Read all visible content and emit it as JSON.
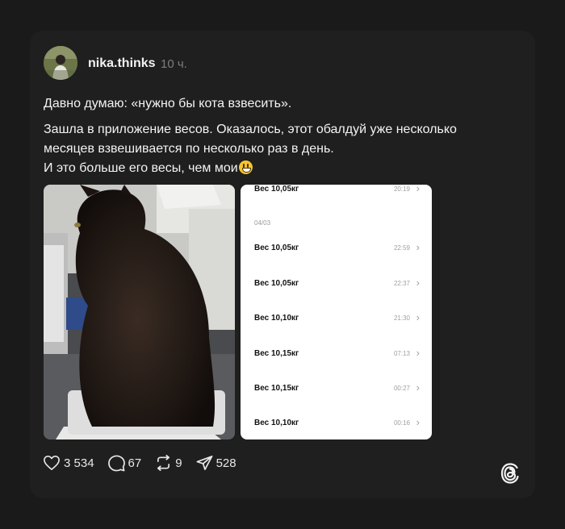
{
  "post": {
    "username": "nika.thinks",
    "time": "10 ч.",
    "paragraph1": "Давно думаю: «нужно бы кота взвесить».",
    "paragraph2_line1": "Зашла в приложение весов. Оказалось, этот обалдуй уже несколько",
    "paragraph2_line2": "месяцев взвешивается по несколько раз в день.",
    "paragraph2_line3": "И это больше его весы, чем мои",
    "emoji": "grinning-face"
  },
  "screenshot": {
    "top_row": {
      "label": "Вес 10,05кг",
      "time": "20:19"
    },
    "date_header": "04/03",
    "rows": [
      {
        "label": "Вес 10,05кг",
        "time": "22:59"
      },
      {
        "label": "Вес 10,05кг",
        "time": "22:37"
      },
      {
        "label": "Вес 10,10кг",
        "time": "21:30"
      },
      {
        "label": "Вес 10,15кг",
        "time": "07:13"
      },
      {
        "label": "Вес 10,15кг",
        "time": "00:27"
      },
      {
        "label": "Вес 10,10кг",
        "time": "00:16"
      }
    ]
  },
  "actions": {
    "likes": "3 534",
    "comments": "67",
    "reposts": "9",
    "shares": "528"
  },
  "icons": [
    "heart-icon",
    "comment-icon",
    "repost-icon",
    "share-icon",
    "threads-logo-icon",
    "chevron-right-icon"
  ],
  "colors": {
    "background": "#1a1a1a",
    "card": "#1f1f1f",
    "text": "#f3f3f3",
    "muted": "#7d7d7d"
  }
}
